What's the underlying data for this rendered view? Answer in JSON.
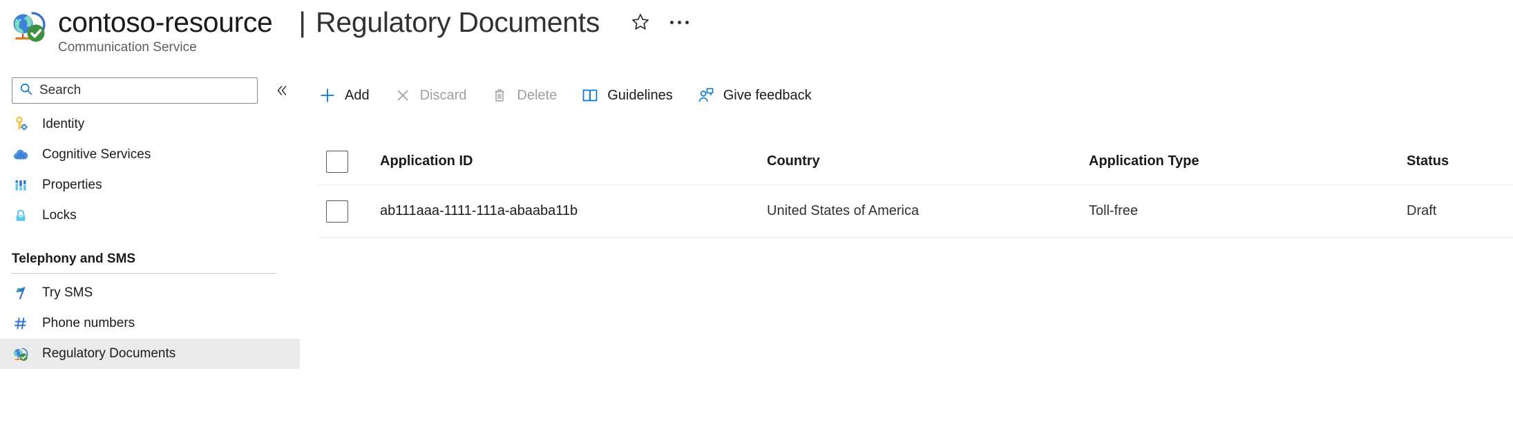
{
  "header": {
    "resource_name": "contoso-resource",
    "resource_type": "Communication Service",
    "separator": "|",
    "page_title": "Regulatory Documents",
    "favorite_icon": "star-icon",
    "more_icon": "ellipsis-icon",
    "resource_icon": "globe-check-icon"
  },
  "sidebar": {
    "search": {
      "placeholder": "Search",
      "value": "",
      "icon": "search-icon"
    },
    "collapse_icon": "double-chevron-left-icon",
    "items": [
      {
        "label": "Identity",
        "icon": "key-icon",
        "selected": false
      },
      {
        "label": "Cognitive Services",
        "icon": "cloud-icon",
        "selected": false
      },
      {
        "label": "Properties",
        "icon": "properties-bars-icon",
        "selected": false
      },
      {
        "label": "Locks",
        "icon": "lock-icon",
        "selected": false
      }
    ],
    "group": {
      "title": "Telephony and SMS",
      "items": [
        {
          "label": "Try SMS",
          "icon": "flag-icon",
          "selected": false
        },
        {
          "label": "Phone numbers",
          "icon": "hash-icon",
          "selected": false
        },
        {
          "label": "Regulatory Documents",
          "icon": "globe-check-icon",
          "selected": true
        }
      ]
    }
  },
  "toolbar": {
    "commands": [
      {
        "label": "Add",
        "icon": "plus-icon",
        "disabled": false
      },
      {
        "label": "Discard",
        "icon": "cross-icon",
        "disabled": true
      },
      {
        "label": "Delete",
        "icon": "trash-icon",
        "disabled": true
      },
      {
        "label": "Guidelines",
        "icon": "book-icon",
        "disabled": false
      },
      {
        "label": "Give feedback",
        "icon": "feedback-person-icon",
        "disabled": false
      }
    ]
  },
  "table": {
    "columns": [
      "Application ID",
      "Country",
      "Application Type",
      "Status"
    ],
    "select_all_checked": false,
    "rows": [
      {
        "checked": false,
        "application_id": "ab111aaa-1111-111a-abaaba11b",
        "country": "United States of America",
        "application_type": "Toll-free",
        "status": "Draft"
      }
    ]
  },
  "colors": {
    "accent_blue": "#0078d4",
    "disabled_gray": "#a19f9d",
    "selected_bg": "#ebebeb",
    "row_divider": "#edebe9",
    "text_primary": "#1b1a19",
    "text_secondary": "#605e5c"
  }
}
